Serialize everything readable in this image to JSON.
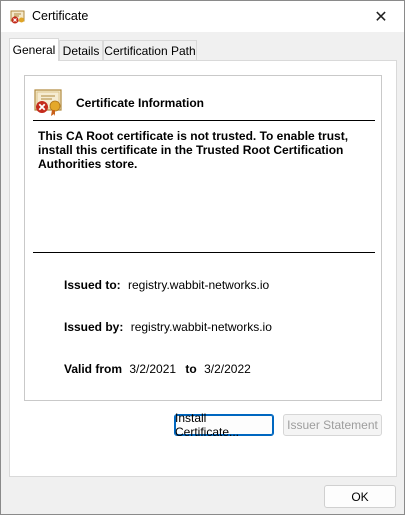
{
  "window": {
    "title": "Certificate",
    "close_glyph": "✕"
  },
  "tabs": [
    {
      "label": "General",
      "active": true
    },
    {
      "label": "Details",
      "active": false
    },
    {
      "label": "Certification Path",
      "active": false
    }
  ],
  "info": {
    "header": "Certificate Information",
    "warning": "This CA Root certificate is not trusted. To enable trust, install this certificate in the Trusted Root Certification Authorities store.",
    "issued_to_label": "Issued to:",
    "issued_to_value": "registry.wabbit-networks.io",
    "issued_by_label": "Issued by:",
    "issued_by_value": "registry.wabbit-networks.io",
    "valid_from_label": "Valid from",
    "valid_from_value": "3/2/2021",
    "valid_to_label": "to",
    "valid_to_value": "3/2/2022"
  },
  "buttons": {
    "install_certificate": "Install Certificate...",
    "issuer_statement": "Issuer Statement",
    "ok": "OK"
  },
  "icons": {
    "title": "certificate-icon",
    "info": "untrusted-certificate-icon"
  },
  "colors": {
    "focus_border": "#0067c0",
    "disabled_text": "#9d9d9d",
    "error_red": "#c42b1c"
  }
}
